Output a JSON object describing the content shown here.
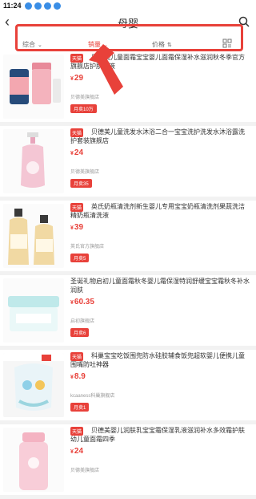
{
  "status": {
    "time": "11:24"
  },
  "header": {
    "title": "母婴"
  },
  "filters": [
    {
      "label": "综合"
    },
    {
      "label": "销量"
    },
    {
      "label": "价格"
    }
  ],
  "products": [
    {
      "tag": "天猫",
      "name": "贝德美儿童面霜宝宝婴儿面霜保湿补水滋润秋冬季官方旗舰店护肤乳液",
      "price": "29",
      "shop": "贝德美旗舰店",
      "sold": "月卖10万"
    },
    {
      "tag": "天猫",
      "name": "贝德美儿童洗发水沐浴二合一宝宝洗护洗发水沐浴露洗护套装旗舰店",
      "price": "24",
      "shop": "贝德美旗舰店",
      "sold": "月卖35"
    },
    {
      "tag": "天猫",
      "name": "英氏奶瓶清洗剂新生婴儿专用宝宝奶瓶清洗剂果蔬洗洁精奶瓶清洗液",
      "price": "39",
      "shop": "英氏官方旗舰店",
      "sold": "月卖5"
    },
    {
      "tag": "",
      "name": "圣诞礼物启初儿童面霜秋冬婴儿霜保湿特润舒缓宝宝霜秋冬补水润肤",
      "price": "60.35",
      "shop": "启初旗舰店",
      "sold": "月卖6"
    },
    {
      "tag": "天猫",
      "name": "科巢宝宝吃饭围兜防水硅胶辅食饭兜超软婴儿便携儿童围嘴防吐神器",
      "price": "8.9",
      "shop": "kcaaness科巢旗舰店",
      "sold": "月卖1"
    },
    {
      "tag": "天猫",
      "name": "贝德美婴儿润肤乳宝宝霜保湿乳液滋润补水多效霜护肤幼儿童面霜四季",
      "price": "24",
      "shop": "贝德美旗舰店",
      "sold": ""
    }
  ]
}
